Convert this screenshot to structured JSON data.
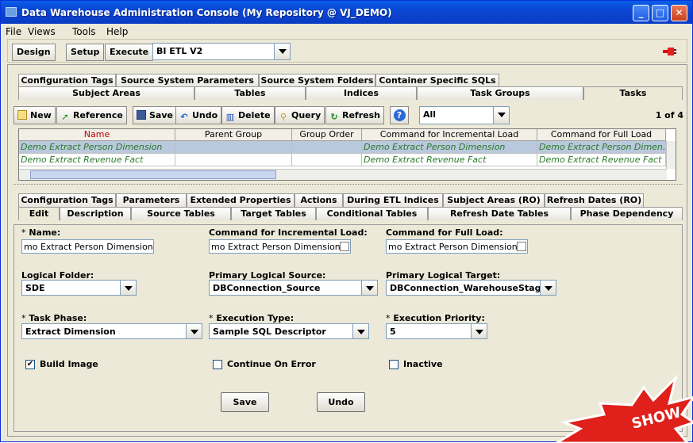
{
  "window": {
    "title": "Data Warehouse Administration Console (My Repository @ VJ_DEMO)",
    "min_icon": "minimize-icon",
    "max_icon": "maximize-icon",
    "close_icon": "close-icon"
  },
  "menu": [
    "File",
    "Views",
    "Tools",
    "Help"
  ],
  "toolbar": {
    "design": "Design",
    "setup": "Setup",
    "execute": "Execute",
    "container": "BI ETL V2"
  },
  "top_tabs_row1": [
    "Configuration Tags",
    "Source System Parameters",
    "Source System Folders",
    "Container Specific SQLs"
  ],
  "top_tabs_row2": [
    "Subject Areas",
    "Tables",
    "Indices",
    "Task Groups",
    "Tasks"
  ],
  "actions": {
    "new": "New",
    "reference": "Reference",
    "save": "Save",
    "undo": "Undo",
    "delete": "Delete",
    "query": "Query",
    "refresh": "Refresh",
    "help": "?",
    "filter": "All",
    "page": "1 of 4"
  },
  "grid": {
    "headers": [
      "Name",
      "Parent Group",
      "Group Order",
      "Command for Incremental Load",
      "Command for Full Load"
    ],
    "rows": [
      [
        "Demo Extract Person Dimension",
        "",
        "",
        "Demo Extract Person Dimension",
        "Demo Extract Person Dimen..."
      ],
      [
        "Demo Extract Revenue Fact",
        "",
        "",
        "Demo Extract Revenue Fact",
        "Demo Extract Revenue Fact"
      ]
    ]
  },
  "detail_tabs_row1": [
    "Configuration Tags",
    "Parameters",
    "Extended Properties",
    "Actions",
    "During ETL Indices",
    "Subject Areas (RO)",
    "Refresh Dates (RO)"
  ],
  "detail_tabs_row2": [
    "Edit",
    "Description",
    "Source Tables",
    "Target Tables",
    "Conditional Tables",
    "Refresh Date Tables",
    "Phase Dependency"
  ],
  "form": {
    "name_label": "Name:",
    "name_value": "mo Extract Person Dimension",
    "inc_label": "Command for Incremental Load:",
    "inc_value": "mo Extract Person Dimension",
    "full_label": "Command for Full Load:",
    "full_value": "mo Extract Person Dimension",
    "folder_label": "Logical Folder:",
    "folder_value": "SDE",
    "source_label": "Primary Logical Source:",
    "source_value": "DBConnection_Source",
    "target_label": "Primary Logical Target:",
    "target_value": "DBConnection_WarehouseStage",
    "phase_label": "Task Phase:",
    "phase_value": "Extract Dimension",
    "exec_label": "Execution Type:",
    "exec_value": "Sample SQL Descriptor",
    "prio_label": "Execution Priority:",
    "prio_value": "5",
    "build_label": "Build Image",
    "build_checked": "✔",
    "continue_label": "Continue On Error",
    "inactive_label": "Inactive",
    "save": "Save",
    "undo": "Undo",
    "required": "*"
  },
  "badge": "SHOW"
}
